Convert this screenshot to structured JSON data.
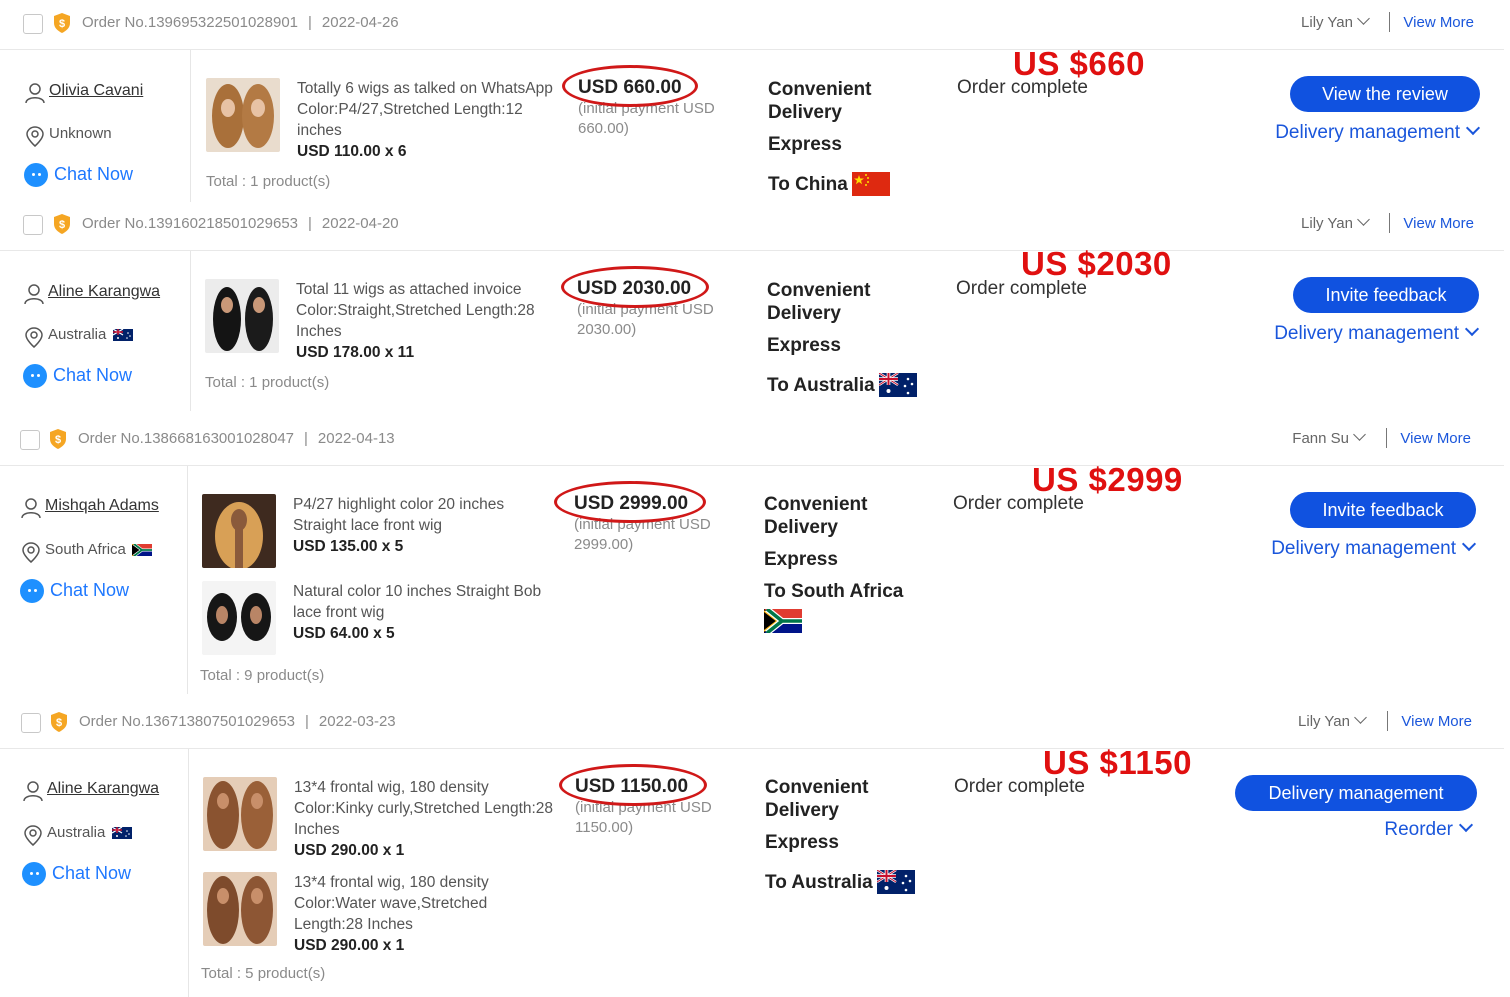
{
  "common": {
    "total_sep": " : ",
    "chat_now": "Chat Now",
    "view_more": "View More"
  },
  "orders": [
    {
      "order_no": "Order No.139695322501028901",
      "date": "2022-04-26",
      "seller": "Lily Yan",
      "buyer": "Olivia Cavani",
      "location": "Unknown",
      "products": [
        {
          "line1": "Totally 6 wigs as talked on WhatsApp",
          "line2": "Color:P4/27,Stretched Length:12",
          "line3": "inches",
          "price": "USD 110.00 x 6"
        }
      ],
      "total": "Total : 1 product(s)",
      "amount": "USD 660.00",
      "initial_payment": "(initial payment USD",
      "initial_amount": "660.00)",
      "delivery": [
        "Convenient",
        "Delivery",
        "Express"
      ],
      "destination": "To China",
      "status": "Order complete",
      "annotation": "US $660",
      "primary_action": "View the review",
      "secondary_action": "Delivery management"
    },
    {
      "order_no": "Order No.139160218501029653",
      "date": "2022-04-20",
      "seller": "Lily Yan",
      "buyer": "Aline Karangwa",
      "location": "Australia",
      "products": [
        {
          "line1": "Total 11 wigs as attached invoice",
          "line2": "Color:Straight,Stretched Length:28",
          "line3": "Inches",
          "price": "USD 178.00 x 11"
        }
      ],
      "total": "Total : 1 product(s)",
      "amount": "USD 2030.00",
      "initial_payment": "(initial payment USD",
      "initial_amount": "2030.00)",
      "delivery": [
        "Convenient",
        "Delivery",
        "Express"
      ],
      "destination": "To Australia",
      "status": "Order complete",
      "annotation": "US $2030",
      "primary_action": "Invite feedback",
      "secondary_action": "Delivery management"
    },
    {
      "order_no": "Order No.138668163001028047",
      "date": "2022-04-13",
      "seller": "Fann Su",
      "buyer": "Mishqah Adams",
      "location": "South Africa",
      "products": [
        {
          "line1": "P4/27 highlight color 20 inches",
          "line2": "Straight lace front wig",
          "line3": "",
          "price": "USD 135.00 x 5"
        },
        {
          "line1": "Natural color 10 inches Straight Bob",
          "line2": "lace front wig",
          "line3": "",
          "price": "USD 64.00 x 5"
        }
      ],
      "total": "Total : 9 product(s)",
      "amount": "USD 2999.00",
      "initial_payment": "(initial payment USD",
      "initial_amount": "2999.00)",
      "delivery": [
        "Convenient",
        "Delivery",
        "Express"
      ],
      "destination": "To South Africa",
      "status": "Order complete",
      "annotation": "US $2999",
      "primary_action": "Invite feedback",
      "secondary_action": "Delivery management"
    },
    {
      "order_no": "Order No.136713807501029653",
      "date": "2022-03-23",
      "seller": "Lily Yan",
      "buyer": "Aline Karangwa",
      "location": "Australia",
      "products": [
        {
          "line1": "13*4 frontal wig, 180 density",
          "line2": "Color:Kinky curly,Stretched Length:28",
          "line3": "Inches",
          "price": "USD 290.00 x 1"
        },
        {
          "line1": "13*4 frontal wig, 180 density",
          "line2": "Color:Water wave,Stretched",
          "line3": "Length:28 Inches",
          "price": "USD 290.00 x 1"
        }
      ],
      "total": "Total : 5 product(s)",
      "amount": "USD 1150.00",
      "initial_payment": "(initial payment USD",
      "initial_amount": "1150.00)",
      "delivery": [
        "Convenient",
        "Delivery",
        "Express"
      ],
      "destination": "To Australia",
      "status": "Order complete",
      "annotation": "US $1150",
      "primary_action": "Delivery management",
      "secondary_action": "Reorder"
    }
  ]
}
